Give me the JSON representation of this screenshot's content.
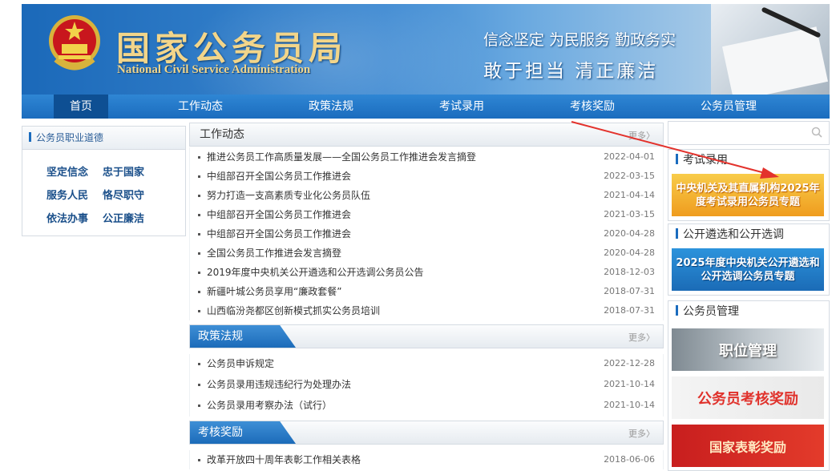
{
  "header": {
    "site_name_cn": "国家公务员局",
    "site_name_en": "National Civil Service Administration",
    "slogan_line1": "信念坚定  为民服务  勤政务实",
    "slogan_line2": "敢于担当    清正廉洁"
  },
  "nav": {
    "items": [
      "首页",
      "工作动态",
      "政策法规",
      "考试录用",
      "考核奖励",
      "公务员管理"
    ],
    "active_index": 0
  },
  "left_box": {
    "title": "公务员职业道德",
    "words": [
      "坚定信念",
      "忠于国家",
      "服务人民",
      "恪尽职守",
      "依法办事",
      "公正廉洁"
    ]
  },
  "work_news": {
    "title": "工作动态",
    "more": "更多〉",
    "items": [
      {
        "title": "推进公务员工作高质量发展——全国公务员工作推进会发言摘登",
        "date": "2022-04-01"
      },
      {
        "title": "中组部召开全国公务员工作推进会",
        "date": "2022-03-15"
      },
      {
        "title": "努力打造一支高素质专业化公务员队伍",
        "date": "2021-04-14"
      },
      {
        "title": "中组部召开全国公务员工作推进会",
        "date": "2021-03-15"
      },
      {
        "title": "中组部召开全国公务员工作推进会",
        "date": "2020-04-28"
      },
      {
        "title": "全国公务员工作推进会发言摘登",
        "date": "2020-04-28"
      },
      {
        "title": "2019年度中央机关公开遴选和公开选调公务员公告",
        "date": "2018-12-03"
      },
      {
        "title": "新疆叶城公务员享用“廉政套餐”",
        "date": "2018-07-31"
      },
      {
        "title": "山西临汾尧都区创新模式抓实公务员培训",
        "date": "2018-07-31"
      }
    ]
  },
  "policy": {
    "title": "政策法规",
    "more": "更多〉",
    "items": [
      {
        "title": "公务员申诉规定",
        "date": "2022-12-28"
      },
      {
        "title": "公务员录用违规违纪行为处理办法",
        "date": "2021-10-14"
      },
      {
        "title": "公务员录用考察办法（试行）",
        "date": "2021-10-14"
      }
    ]
  },
  "reward": {
    "title": "考核奖励",
    "more": "更多〉",
    "items": [
      {
        "title": "改革开放四十周年表彰工作相关表格",
        "date": "2018-06-06"
      }
    ]
  },
  "right": {
    "exam_title": "考试录用",
    "exam_banner": "中央机关及其直属机构2025年度考试录用公务员专题",
    "selection_title": "公开遴选和公开选调",
    "selection_banner": "2025年度中央机关公开遴选和公开选调公务员专题",
    "mgmt_title": "公务员管理",
    "mgmt_banners": [
      "职位管理",
      "公务员考核奖励",
      "国家表彰奖励"
    ]
  },
  "colors": {
    "nav_blue": "#1b6cbe",
    "nav_active": "#0e4f93",
    "arrow_red": "#e3322c",
    "title_gold": "#f2d58a"
  }
}
